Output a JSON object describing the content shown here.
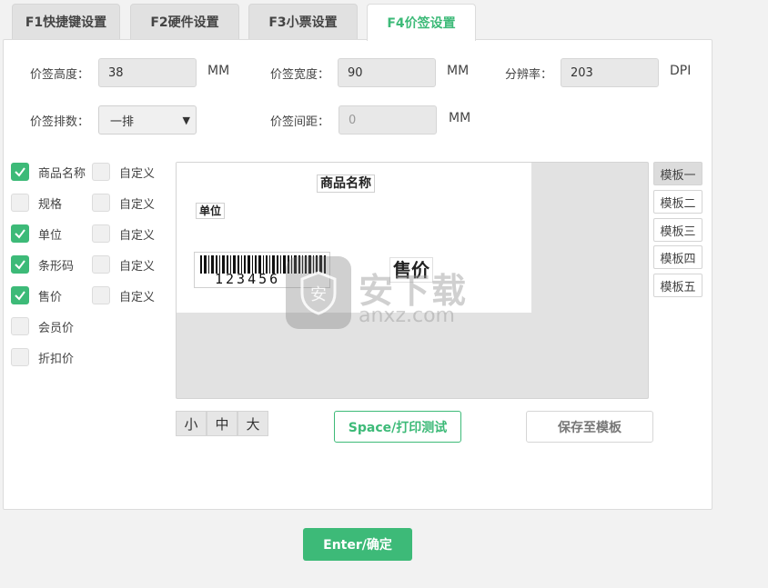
{
  "tabs": [
    {
      "label": "F1快捷键设置",
      "active": false
    },
    {
      "label": "F2硬件设置",
      "active": false
    },
    {
      "label": "F3小票设置",
      "active": false
    },
    {
      "label": "F4价签设置",
      "active": true
    }
  ],
  "form": {
    "height_label": "价签高度：",
    "height_value": "38",
    "height_unit": "MM",
    "width_label": "价签宽度：",
    "width_value": "90",
    "width_unit": "MM",
    "dpi_label": "分辨率：",
    "dpi_value": "203",
    "dpi_unit": "DPI",
    "rows_label": "价签排数：",
    "rows_value": "一排",
    "gap_label": "价签间距：",
    "gap_value": "0",
    "gap_unit": "MM"
  },
  "fields": [
    {
      "label": "商品名称",
      "checked": true,
      "custom_label": "自定义",
      "custom_checked": false
    },
    {
      "label": "规格",
      "checked": false,
      "custom_label": "自定义",
      "custom_checked": false
    },
    {
      "label": "单位",
      "checked": true,
      "custom_label": "自定义",
      "custom_checked": false
    },
    {
      "label": "条形码",
      "checked": true,
      "custom_label": "自定义",
      "custom_checked": false
    },
    {
      "label": "售价",
      "checked": true,
      "custom_label": "自定义",
      "custom_checked": false
    },
    {
      "label": "会员价",
      "checked": false
    },
    {
      "label": "折扣价",
      "checked": false
    }
  ],
  "preview": {
    "name": "商品名称",
    "unit": "单位",
    "barcode_number": "123456",
    "price": "售价"
  },
  "templates": [
    {
      "label": "模板一",
      "active": true
    },
    {
      "label": "模板二",
      "active": false
    },
    {
      "label": "模板三",
      "active": false
    },
    {
      "label": "模板四",
      "active": false
    },
    {
      "label": "模板五",
      "active": false
    }
  ],
  "sizes": [
    "小",
    "中",
    "大"
  ],
  "buttons": {
    "print_test": "Space/打印测试",
    "save_template": "保存至模板",
    "confirm": "Enter/确定"
  },
  "watermark": {
    "text": "安下载",
    "domain": "anxz.com"
  },
  "colors": {
    "accent": "#3dba78",
    "panel": "#ffffff",
    "background": "#f2f2f2"
  }
}
